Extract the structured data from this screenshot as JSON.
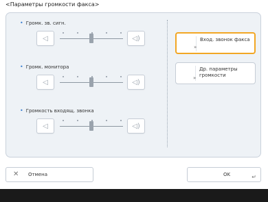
{
  "header": {
    "title": "<Параметры громкости факса>"
  },
  "sections": [
    {
      "label": "Громк. зв. сигн.",
      "level": 0.5
    },
    {
      "label": "Громк. монитора",
      "level": 0.5
    },
    {
      "label": "Громкость входящ. звонка",
      "level": 0.5
    }
  ],
  "side_buttons": [
    {
      "label": "Вход. звонок факса",
      "active": true
    },
    {
      "label": "Др. параметры громкости",
      "active": false
    }
  ],
  "footer_buttons": {
    "cancel": "Отмена",
    "ok": "OK"
  },
  "icons": {
    "volume_down": "volume-down-icon",
    "volume_up": "volume-up-icon",
    "cancel": "close-icon",
    "ok": "enter-icon"
  },
  "colors": {
    "accent": "#f2a623",
    "bullet": "#3a7fd0",
    "panel": "#eef2f6",
    "footer": "#1a1a1a"
  }
}
